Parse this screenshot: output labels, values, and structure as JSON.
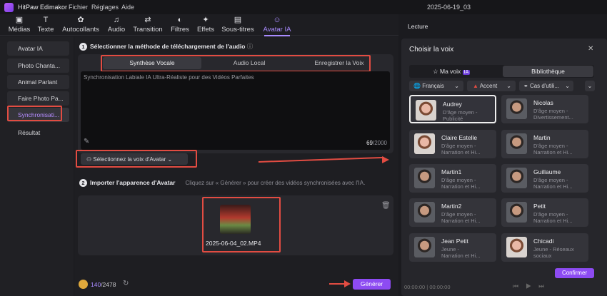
{
  "app": {
    "name": "HitPaw Edimakor",
    "menu": [
      "Fichier",
      "Réglages",
      "Aide"
    ],
    "title": "2025-06-19_03"
  },
  "toolbar": {
    "items": [
      {
        "label": "Médias",
        "icon": "media-icon"
      },
      {
        "label": "Texte",
        "icon": "text-icon"
      },
      {
        "label": "Autocollants",
        "icon": "sticker-icon"
      },
      {
        "label": "Audio",
        "icon": "audio-icon"
      },
      {
        "label": "Transition",
        "icon": "transition-icon"
      },
      {
        "label": "Filtres",
        "icon": "filter-icon"
      },
      {
        "label": "Effets",
        "icon": "effects-icon"
      },
      {
        "label": "Sous-titres",
        "icon": "subtitles-icon"
      },
      {
        "label": "Avatar IA",
        "icon": "avatar-icon"
      }
    ],
    "active": "Avatar IA"
  },
  "sidebar": {
    "items": [
      "Avatar IA",
      "Photo Chanta...",
      "Animal Parlant",
      "Faire Photo Pa...",
      "Synchronisati...",
      "Résultat"
    ],
    "active": "Synchronisati..."
  },
  "step1": {
    "num": "1",
    "title": "Sélectionner la méthode de téléchargement de l'audio"
  },
  "tabs": [
    "Synthèse Vocale",
    "Audio Local",
    "Enregistrer la Voix"
  ],
  "textarea": {
    "text": "Synchronisation Labiale IA Ultra-Réaliste pour des Vidéos Parfaites",
    "count": "69",
    "max": "/2000"
  },
  "voice_button": "Sélectionnez la voix d'Avatar",
  "step2": {
    "num": "2",
    "title": "Importer l'apparence d'Avatar",
    "hint": "Cliquez sur « Générer » pour créer des vidéos synchronisées avec l'IA."
  },
  "media": {
    "filename": "2025-06-04_02.MP4"
  },
  "credits": {
    "used": "140",
    "total": "/2478"
  },
  "generate": "Générer",
  "right_title": "Lecture",
  "modal": {
    "title": "Choisir la voix",
    "tab_my": "Ma voix",
    "tab_my_badge": "IA",
    "tab_lib": "Bibliothèque",
    "filters": [
      "Français",
      "Accent",
      "Cas d'utili..."
    ],
    "confirm": "Confirmer"
  },
  "voices": [
    {
      "name": "Audrey",
      "desc1": "D'âge moyen -",
      "desc2": "Publicité",
      "gender": "f"
    },
    {
      "name": "Nicolas",
      "desc1": "D'âge moyen -",
      "desc2": "Divertissement...",
      "gender": "m"
    },
    {
      "name": "Claire Estelle",
      "desc1": "D'âge moyen -",
      "desc2": "Narration et Hi...",
      "gender": "f"
    },
    {
      "name": "Martin",
      "desc1": "D'âge moyen -",
      "desc2": "Narration et Hi...",
      "gender": "m"
    },
    {
      "name": "Martin1",
      "desc1": "D'âge moyen -",
      "desc2": "Narration et Hi...",
      "gender": "m"
    },
    {
      "name": "Guillaume",
      "desc1": "D'âge moyen -",
      "desc2": "Narration et Hi...",
      "gender": "m"
    },
    {
      "name": "Martin2",
      "desc1": "D'âge moyen -",
      "desc2": "Narration et Hi...",
      "gender": "m"
    },
    {
      "name": "Petit",
      "desc1": "D'âge moyen -",
      "desc2": "Narration et Hi...",
      "gender": "m"
    },
    {
      "name": "Jean Petit",
      "desc1": "Jeune -",
      "desc2": "Narration et Hi...",
      "gender": "m"
    },
    {
      "name": "Chicadi",
      "desc1": "Jeune - Réseaux",
      "desc2": "sociaux",
      "gender": "f"
    }
  ],
  "timecode": {
    "current": "00:00:00",
    "total": "00:00:00"
  },
  "colors": {
    "accent": "#8d4bf2",
    "highlight": "#e24c42"
  }
}
